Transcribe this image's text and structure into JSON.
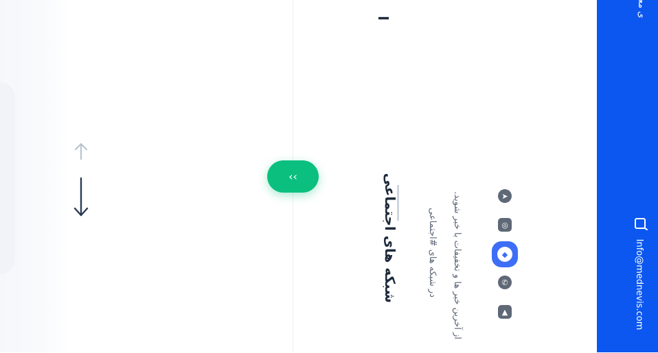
{
  "social": {
    "title": "شبکه های اجتماعی",
    "line1": "در شبکه های #اجتماعی",
    "line2": "از آخرین خبر ها و تخفیفات با خبر شوید.",
    "icons": [
      "telegram-icon",
      "instagram-icon",
      "aparat-icon",
      "whatsapp-icon",
      "youtube-icon"
    ]
  },
  "scroll_button": {
    "label": "‹‹"
  },
  "footer": {
    "email": "Info@mednevis.com",
    "teacher_text": "ی معلم",
    "accent": "#0b57ef"
  },
  "top_partial": "ا",
  "colors": {
    "green": "#0bbf7f",
    "blue": "#0b57ef",
    "active_icon": "#3d6ef5"
  }
}
